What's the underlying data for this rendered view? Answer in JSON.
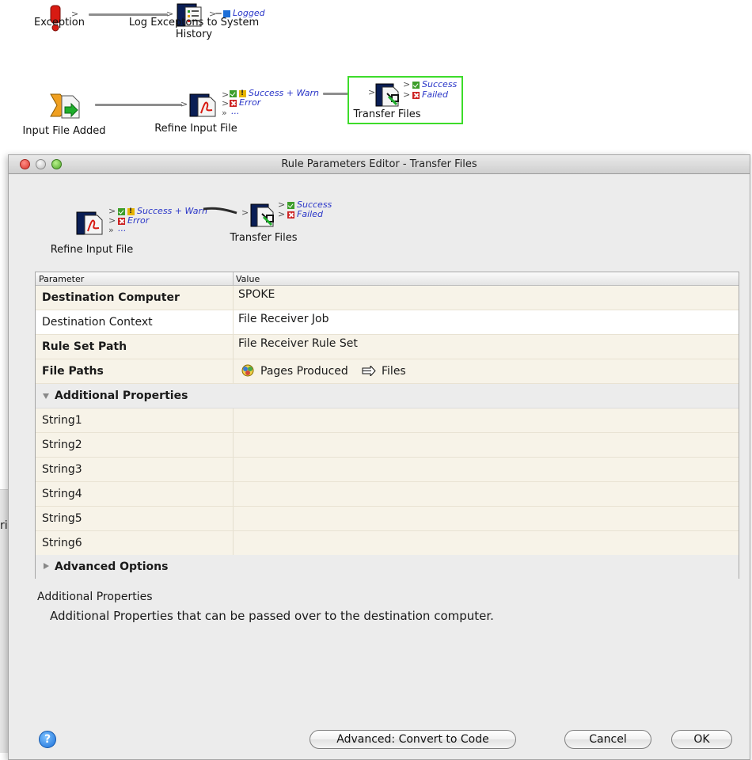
{
  "background_flow": {
    "row1": {
      "trigger": {
        "label": "Exception",
        "icon": "exclamation-icon"
      },
      "action": {
        "label": "Log Exceptons to System History",
        "label_line1": "Log Exceptons to System",
        "label_line2": "History",
        "icon": "log-document-icon"
      },
      "status_logged": "Logged"
    },
    "row2": {
      "trigger": {
        "label": "Input File Added",
        "icon": "file-added-icon"
      },
      "refine": {
        "label": "Refine Input File",
        "icon": "pdf-refine-icon"
      },
      "status_success_warn": "Success + Warn",
      "status_error": "Error",
      "status_more": "...",
      "transfer": {
        "label": "Transfer Files",
        "icon": "transfer-files-icon"
      },
      "status_success": "Success",
      "status_failed": "Failed"
    }
  },
  "left_fragment": "rip",
  "dialog": {
    "title": "Rule Parameters Editor - Transfer Files",
    "mini_flow": {
      "refine_label": "Refine Input File",
      "status_success_warn": "Success + Warn",
      "status_error": "Error",
      "status_more": "...",
      "transfer_label": "Transfer Files",
      "status_success": "Success",
      "status_failed": "Failed"
    },
    "table": {
      "headers": {
        "parameter": "Parameter",
        "value": "Value"
      },
      "rows": [
        {
          "name": "Destination Computer",
          "value": "SPOKE",
          "bold": true
        },
        {
          "name": "Destination Context",
          "value": "File Receiver Job",
          "bold": false
        },
        {
          "name": "Rule Set Path",
          "value": "File Receiver Rule Set",
          "bold": true
        },
        {
          "name": "File Paths",
          "value_source": "Pages Produced",
          "value_target": "Files",
          "bold": true
        }
      ],
      "section_additional": "Additional Properties",
      "string_rows": [
        "String1",
        "String2",
        "String3",
        "String4",
        "String5",
        "String6"
      ],
      "section_advanced": "Advanced Options"
    },
    "description": {
      "title": "Additional Properties",
      "body": "Additional Properties that can be passed over to the destination computer."
    },
    "buttons": {
      "help": "?",
      "convert": "Advanced: Convert to Code",
      "cancel": "Cancel",
      "ok": "OK"
    }
  },
  "colors": {
    "selection_border": "#3ddc2a",
    "status_text": "#2a36c8",
    "row_alt": "#f7f3e8"
  }
}
